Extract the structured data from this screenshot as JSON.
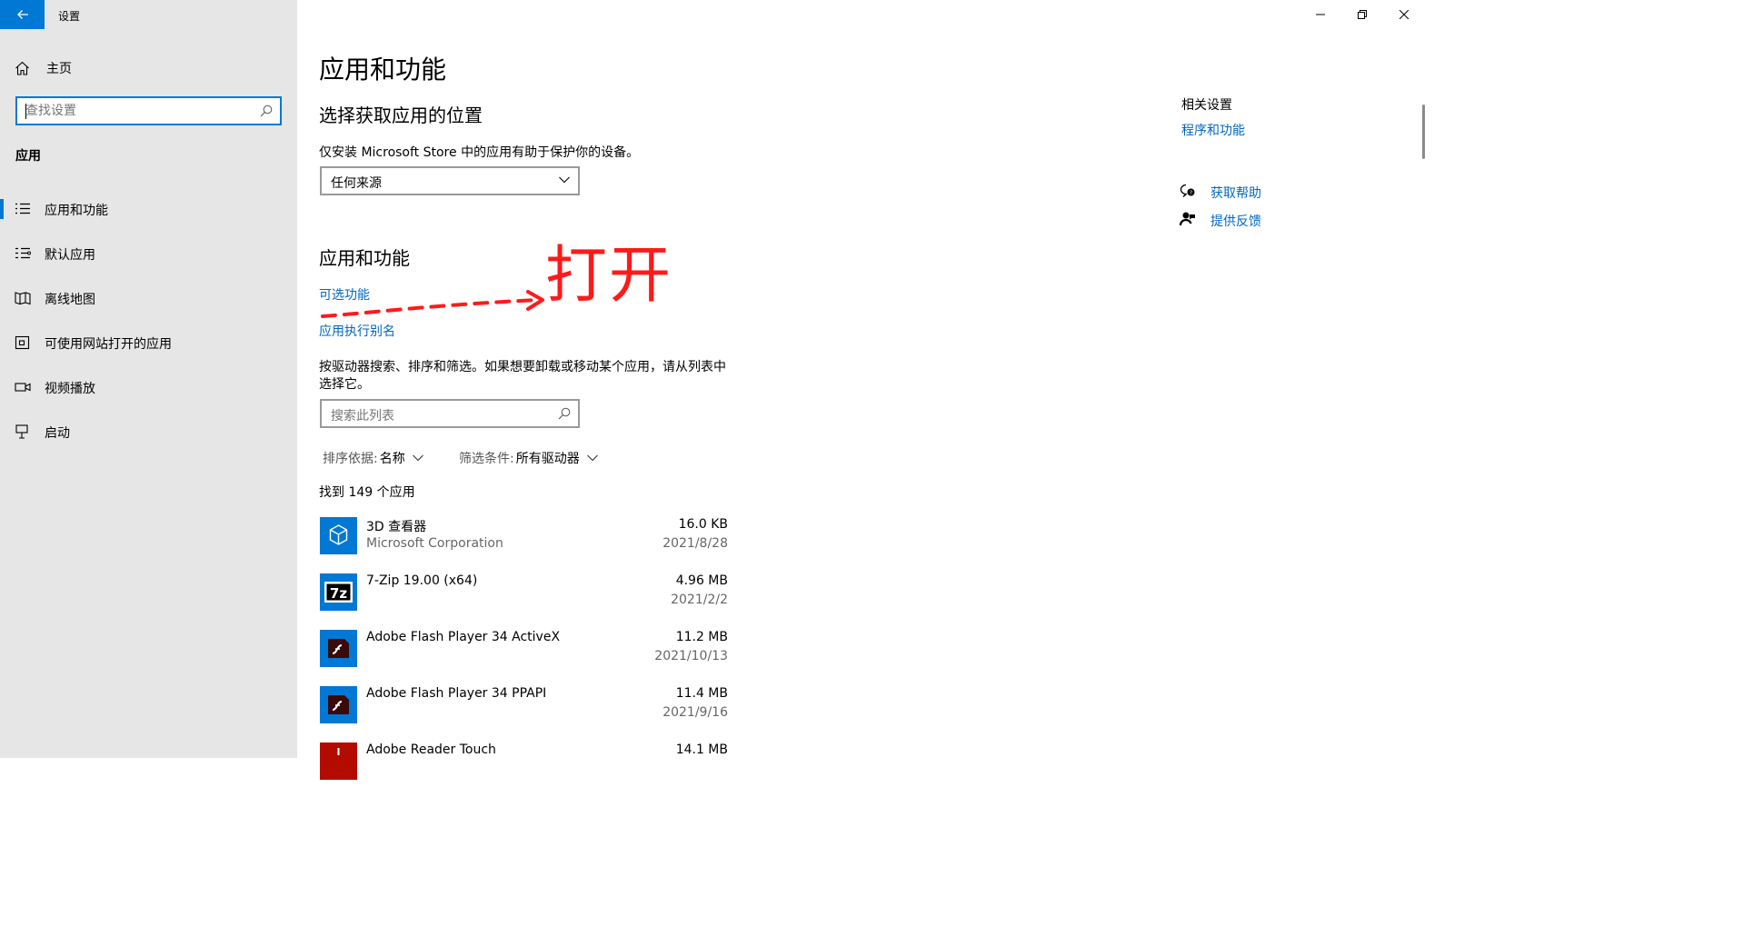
{
  "window": {
    "title": "设置",
    "controls": [
      "minimize",
      "restore",
      "close"
    ]
  },
  "sidebar": {
    "home_label": "主页",
    "search_placeholder": "查找设置",
    "section_header": "应用",
    "items": [
      {
        "label": "应用和功能",
        "icon": "apps-list-icon",
        "active": true
      },
      {
        "label": "默认应用",
        "icon": "default-apps-icon",
        "active": false
      },
      {
        "label": "离线地图",
        "icon": "offline-maps-icon",
        "active": false
      },
      {
        "label": "可使用网站打开的应用",
        "icon": "apps-for-websites-icon",
        "active": false
      },
      {
        "label": "视频播放",
        "icon": "video-playback-icon",
        "active": false
      },
      {
        "label": "启动",
        "icon": "startup-icon",
        "active": false
      }
    ]
  },
  "main": {
    "page_title": "应用和功能",
    "location_section": {
      "heading": "选择获取应用的位置",
      "description": "仅安装 Microsoft Store 中的应用有助于保护你的设备。",
      "dropdown_value": "任何来源"
    },
    "apps_section": {
      "heading": "应用和功能",
      "link_optional_features": "可选功能",
      "link_app_aliases": "应用执行别名",
      "description_line1": "按驱动器搜索、排序和筛选。如果想要卸载或移动某个应用，请从列表中",
      "description_line2": "选择它。",
      "search_placeholder": "搜索此列表",
      "sort_key": "排序依据:",
      "sort_value": "名称",
      "filter_key": "筛选条件:",
      "filter_value": "所有驱动器",
      "count_text": "找到 149 个应用"
    },
    "apps": [
      {
        "name": "3D 查看器",
        "publisher": "Microsoft Corporation",
        "size": "16.0 KB",
        "date": "2021/8/28",
        "icon": "3d-viewer-icon"
      },
      {
        "name": "7-Zip 19.00 (x64)",
        "publisher": "",
        "size": "4.96 MB",
        "date": "2021/2/2",
        "icon": "7zip-icon"
      },
      {
        "name": "Adobe Flash Player 34 ActiveX",
        "publisher": "",
        "size": "11.2 MB",
        "date": "2021/10/13",
        "icon": "flash-player-icon"
      },
      {
        "name": "Adobe Flash Player 34 PPAPI",
        "publisher": "",
        "size": "11.4 MB",
        "date": "2021/9/16",
        "icon": "flash-player-icon"
      },
      {
        "name": "Adobe Reader Touch",
        "publisher": "",
        "size": "14.1 MB",
        "date": "",
        "icon": "adobe-reader-icon"
      }
    ],
    "related": {
      "heading": "相关设置",
      "programs_link": "程序和功能",
      "get_help": "获取帮助",
      "feedback": "提供反馈"
    },
    "annotation": {
      "text": "打开",
      "color": "#ff1a1a"
    }
  },
  "colors": {
    "accent": "#0078d4",
    "link": "#0067c0",
    "sidebar_bg": "#e6e6e6"
  }
}
